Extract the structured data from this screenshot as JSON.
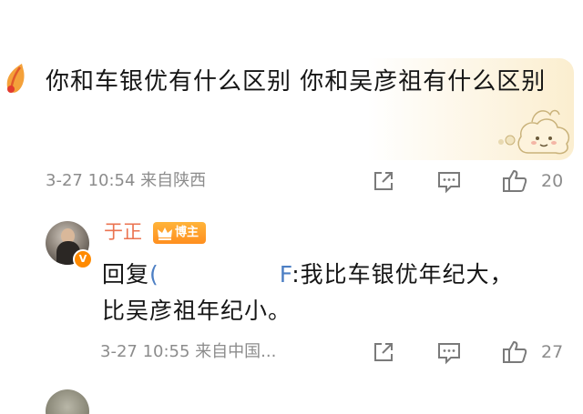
{
  "comment": {
    "text": "你和车银优有什么区别 你和吴彦祖有什么区别",
    "time_location": "3-27 10:54  来自陕西",
    "likes": "20",
    "icons": [
      "leaf-badge-icon",
      "sticker-image",
      "share-icon",
      "comment-icon",
      "thumbs-up-icon"
    ]
  },
  "reply": {
    "username": "于正",
    "badge_label": "博主",
    "prefix": "回复",
    "mention_open": "(",
    "mention_close": "F",
    "line1_rest": ":我比车银优年纪大，",
    "line2": "比吴彦祖年纪小。",
    "time_location": "3-27 10:55  来自中国...",
    "likes": "27",
    "icons": [
      "avatar",
      "verified-badge-icon",
      "crown-icon",
      "share-icon",
      "comment-icon",
      "thumbs-up-icon"
    ]
  },
  "colors": {
    "username": "#eb7350",
    "mention": "#4d7fc4",
    "meta_gray": "#8c8c8c",
    "badge_orange": "#ff8f1f"
  }
}
